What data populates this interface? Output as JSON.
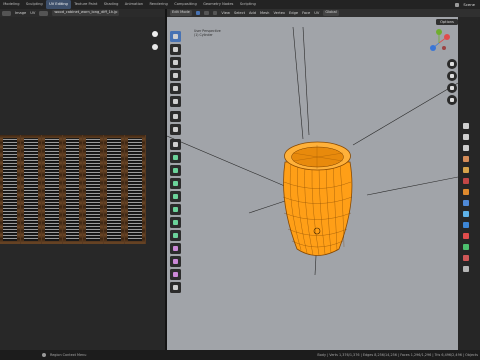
{
  "topbar": {
    "workspaces": [
      "Modeling",
      "Sculpting",
      "UV Editing",
      "Texture Paint",
      "Shading",
      "Animation",
      "Rendering",
      "Compositing",
      "Geometry Nodes",
      "Scripting"
    ],
    "active_workspace": "UV Editing",
    "scene": "Scene"
  },
  "uv_editor": {
    "menus": [
      "Image",
      "UV"
    ],
    "image_name": "wood_cabinet_worn_long_diff_1k.jp"
  },
  "viewport": {
    "mode": "Edit Mode",
    "menus": [
      "View",
      "Select",
      "Add",
      "Mesh",
      "Vertex",
      "Edge",
      "Face",
      "UV"
    ],
    "orientation": "Global",
    "options_label": "Options",
    "info": [
      "User Perspective",
      "(1) Cylinder"
    ]
  },
  "statusbar": {
    "left": "Region Context Menu",
    "right": "Body | Verts 1,376/1,376 | Edges 8,256/14,256 | Faces 1,296/1,296 | Tris 6,496/2,496 | Objects"
  },
  "colors": {
    "selected_mesh": "#ffa21a",
    "active_workspace": "#3d4f6a",
    "active_tool": "#4772b3",
    "viewport_bg": "#a1a4a9"
  }
}
